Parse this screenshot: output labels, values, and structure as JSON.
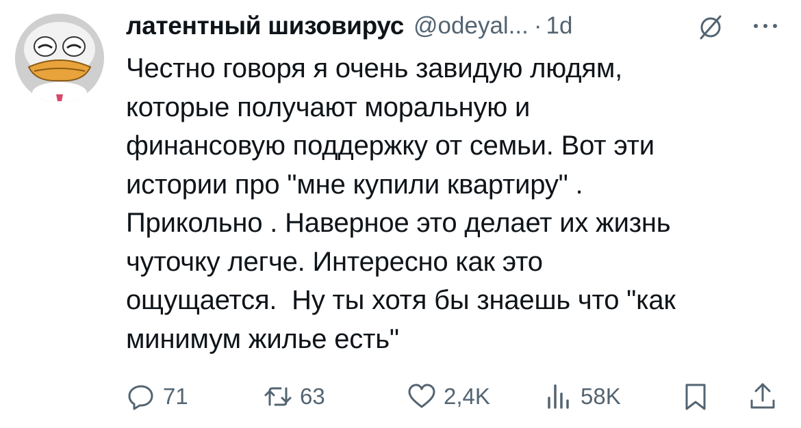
{
  "tweet": {
    "author_name": "латентный шизовирус",
    "handle": "@odeyal...",
    "separator": "·",
    "time": "1d",
    "text": "Честно говоря я очень завидую людям,\nкоторые получают моральную и\nфинансовую поддержку от семьи. Вот эти\nистории про \"мне купили квартиру\" .\nПрикольно . Наверное это делает их жизнь\nчуточку легче. Интересно как это\nощущается.  Ну ты хотя бы знаешь что \"как\nминимум жилье есть\""
  },
  "actions": {
    "replies": "71",
    "reposts": "63",
    "likes": "2,4K",
    "views": "58K"
  },
  "icons": {
    "avatar": "donald-duck-avatar",
    "grok": "grok-icon",
    "more": "more-icon",
    "reply": "reply-icon",
    "repost": "repost-icon",
    "like": "heart-icon",
    "views": "views-icon",
    "bookmark": "bookmark-icon",
    "share": "share-icon"
  },
  "colors": {
    "text": "#0f1419",
    "secondary": "#536471",
    "background": "#ffffff"
  }
}
